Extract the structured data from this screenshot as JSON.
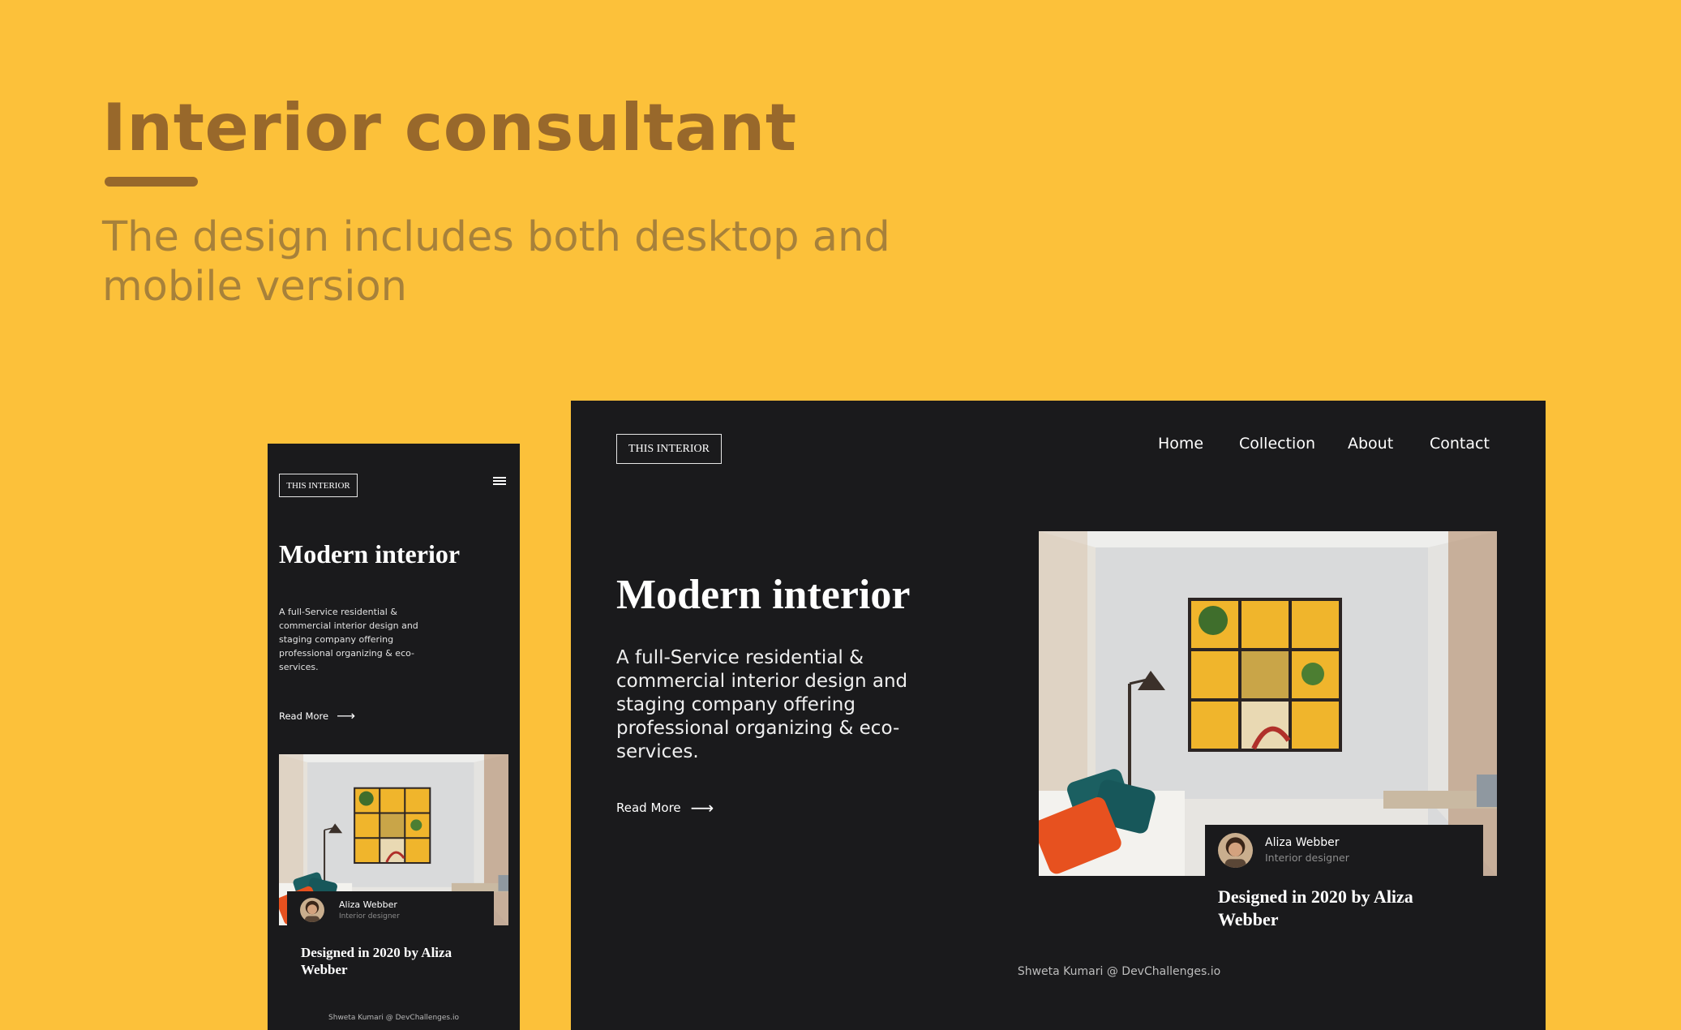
{
  "header": {
    "title": "Interior consultant",
    "subtitle": "The design includes both desktop and mobile version"
  },
  "mobile": {
    "logo": "THIS INTERIOR",
    "menu_icon": "hamburger-menu-icon",
    "heading": "Modern interior",
    "description": "A full-Service residential & commercial interior design and staging company offering professional organizing & eco-services.",
    "read_more": "Read More",
    "arrow": "⟶",
    "designer_name": "Aliza Webber",
    "designer_role": "Interior designer",
    "designed_by": "Designed in 2020 by Aliza Webber",
    "footer": "Shweta Kumari @ DevChallenges.io"
  },
  "desktop": {
    "logo": "THIS INTERIOR",
    "nav": [
      "Home",
      "Collection",
      "About",
      "Contact"
    ],
    "heading": "Modern interior",
    "description": "A full-Service residential & commercial interior design and staging company offering professional organizing & eco-services.",
    "read_more": "Read More",
    "arrow": "⟶",
    "designer_name": "Aliza Webber",
    "designer_role": "Interior designer",
    "designed_by": "Designed in 2020 by Aliza Webber",
    "footer": "Shweta Kumari @ DevChallenges.io"
  },
  "colors": {
    "background": "#FCC13A",
    "title": "#98682B",
    "subtitle": "#A7813A",
    "panel": "#1A1A1C"
  }
}
